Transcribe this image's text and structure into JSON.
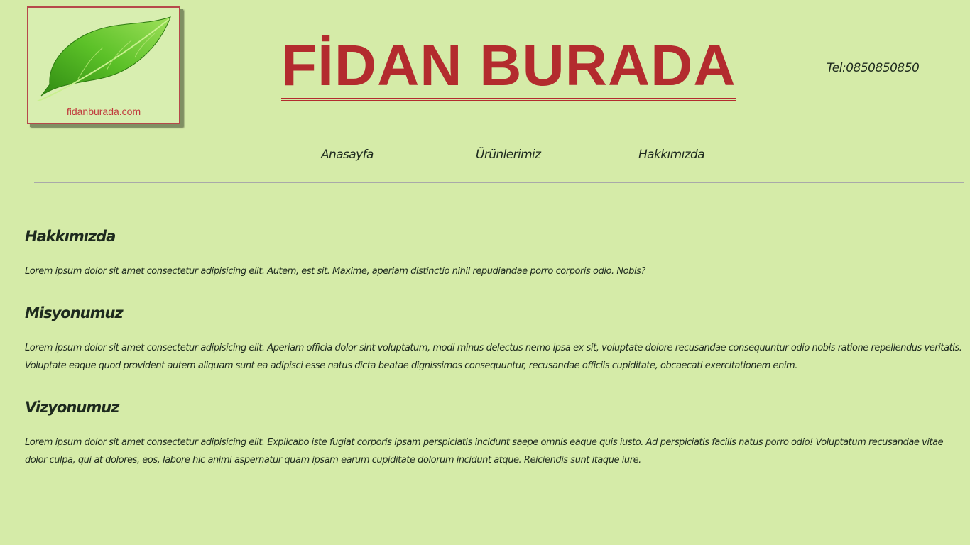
{
  "header": {
    "logo_text": "fidanburada.com",
    "title": "FİDAN BURADA",
    "phone": "Tel:0850850850"
  },
  "nav": {
    "items": [
      {
        "label": "Anasayfa"
      },
      {
        "label": "Ürünlerimiz"
      },
      {
        "label": "Hakkımızda"
      }
    ]
  },
  "sections": [
    {
      "heading": "Hakkımızda",
      "text": "Lorem ipsum dolor sit amet consectetur adipisicing elit. Autem, est sit. Maxime, aperiam distinctio nihil repudiandae porro corporis odio. Nobis?"
    },
    {
      "heading": "Misyonumuz",
      "text": "Lorem ipsum dolor sit amet consectetur adipisicing elit. Aperiam officia dolor sint voluptatum, modi minus delectus nemo ipsa ex sit, voluptate dolore recusandae consequuntur odio nobis ratione repellendus veritatis. Voluptate eaque quod provident autem aliquam sunt ea adipisci esse natus dicta beatae dignissimos consequuntur, recusandae officiis cupiditate, obcaecati exercitationem enim."
    },
    {
      "heading": "Vizyonumuz",
      "text": "Lorem ipsum dolor sit amet consectetur adipisicing elit. Explicabo iste fugiat corporis ipsam perspiciatis incidunt saepe omnis eaque quis iusto. Ad perspiciatis facilis natus porro odio! Voluptatum recusandae vitae dolor culpa, qui at dolores, eos, labore hic animi aspernatur quam ipsam earum cupiditate dolorum incidunt atque. Reiciendis sunt itaque iure."
    }
  ],
  "colors": {
    "background": "#d5eba8",
    "title": "#b32b2e",
    "text": "#1e2a1e",
    "logo_text": "#c0393b",
    "leaf": "#3e9e1c"
  },
  "icons": {
    "logo": "leaf-icon"
  }
}
